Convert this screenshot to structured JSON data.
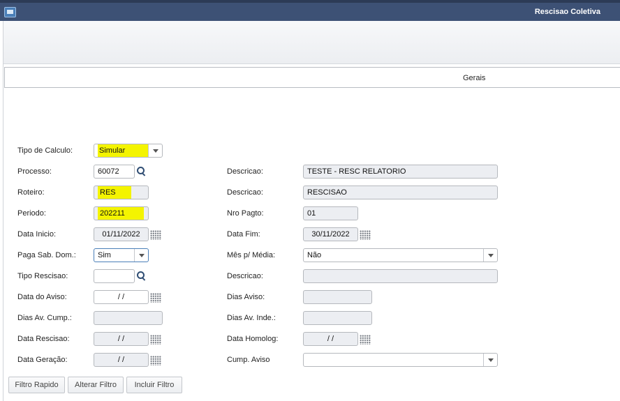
{
  "window": {
    "title": "Rescisao Coletiva"
  },
  "tabs": [
    {
      "label": "Gerais"
    }
  ],
  "form": {
    "tipo_calculo": {
      "label": "Tipo de Calculo:",
      "value": "Simular"
    },
    "processo": {
      "label": "Processo:",
      "value": "60072"
    },
    "descricao_processo": {
      "label": "Descricao:",
      "value": "TESTE - RESC RELATORIO"
    },
    "roteiro": {
      "label": "Roteiro:",
      "value": "RES"
    },
    "descricao_roteiro": {
      "label": "Descricao:",
      "value": "RESCISAO"
    },
    "periodo": {
      "label": "Periodo:",
      "value": "202211"
    },
    "nro_pagto": {
      "label": "Nro Pagto:",
      "value": "01"
    },
    "data_inicio": {
      "label": "Data Inicio:",
      "value": "01/11/2022"
    },
    "data_fim": {
      "label": "Data Fim:",
      "value": "30/11/2022"
    },
    "paga_sab_dom": {
      "label": "Paga Sab. Dom.:",
      "value": "Sim"
    },
    "mes_media": {
      "label": "Mês p/ Média:",
      "value": "Não"
    },
    "tipo_rescisao": {
      "label": "Tipo Rescisao:",
      "value": ""
    },
    "descricao_tipo": {
      "label": "Descricao:",
      "value": ""
    },
    "data_aviso": {
      "label": "Data do Aviso:",
      "value": "/ /"
    },
    "dias_aviso": {
      "label": "Dias Aviso:",
      "value": ""
    },
    "dias_av_cump": {
      "label": "Dias Av. Cump.:",
      "value": ""
    },
    "dias_av_inde": {
      "label": "Dias Av. Inde.:",
      "value": ""
    },
    "data_rescisao": {
      "label": "Data Rescisao:",
      "value": "/ /"
    },
    "data_homolog": {
      "label": "Data Homolog:",
      "value": "/ /"
    },
    "data_geracao": {
      "label": "Data Geração:",
      "value": "/ /"
    },
    "cump_aviso": {
      "label": "Cump. Aviso",
      "value": ""
    }
  },
  "buttons": {
    "filtro_rapido": "Filtro Rapido",
    "alterar_filtro": "Alterar Filtro",
    "incluir_filtro": "Incluir Filtro"
  },
  "icons": {
    "app": "app-window-icon",
    "lookup": "magnifier-icon",
    "calendar": "calendar-grid-icon",
    "dropdown": "chevron-down-icon"
  },
  "colors": {
    "titlebar": "#3d5175",
    "highlight": "#f4f400",
    "readonly_field": "#eceef2"
  }
}
